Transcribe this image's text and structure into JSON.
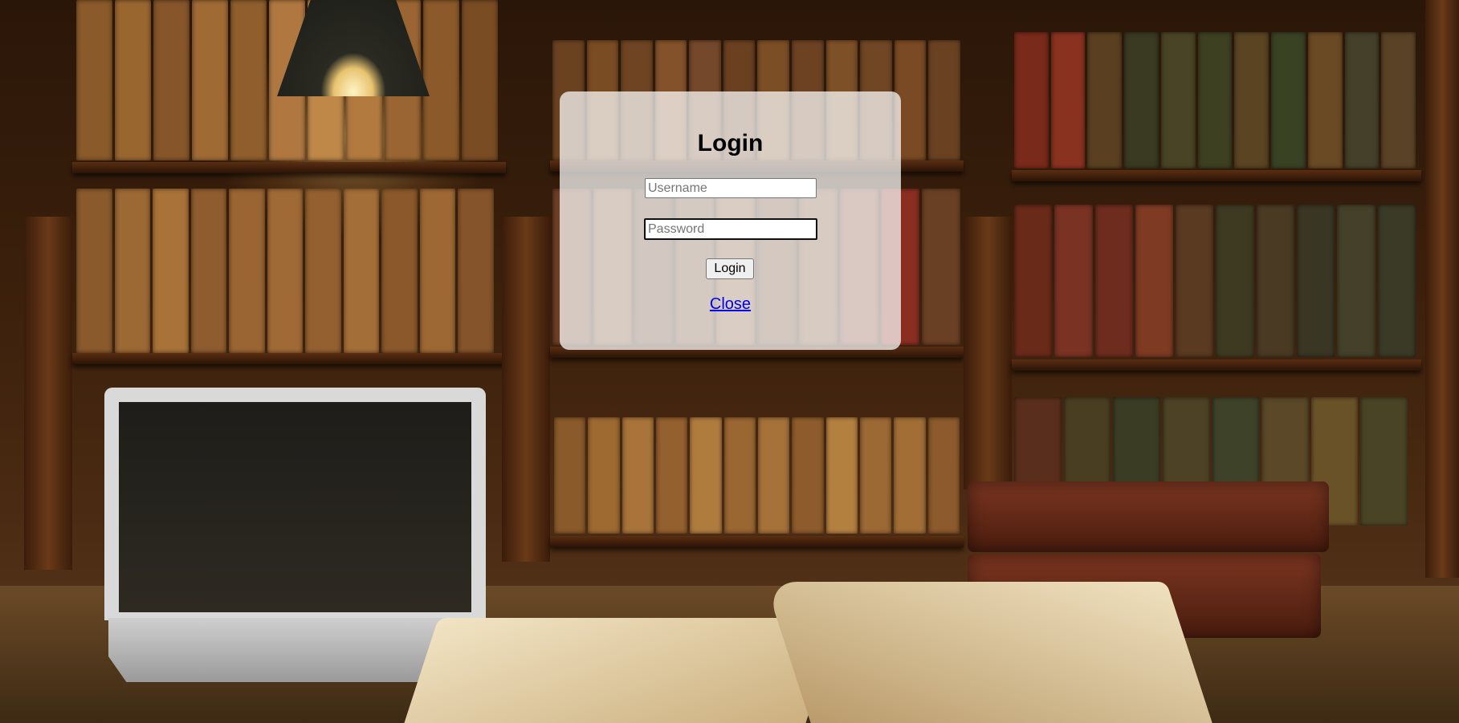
{
  "login": {
    "title": "Login",
    "username_placeholder": "Username",
    "password_placeholder": "Password",
    "submit_label": "Login",
    "close_label": "Close"
  }
}
